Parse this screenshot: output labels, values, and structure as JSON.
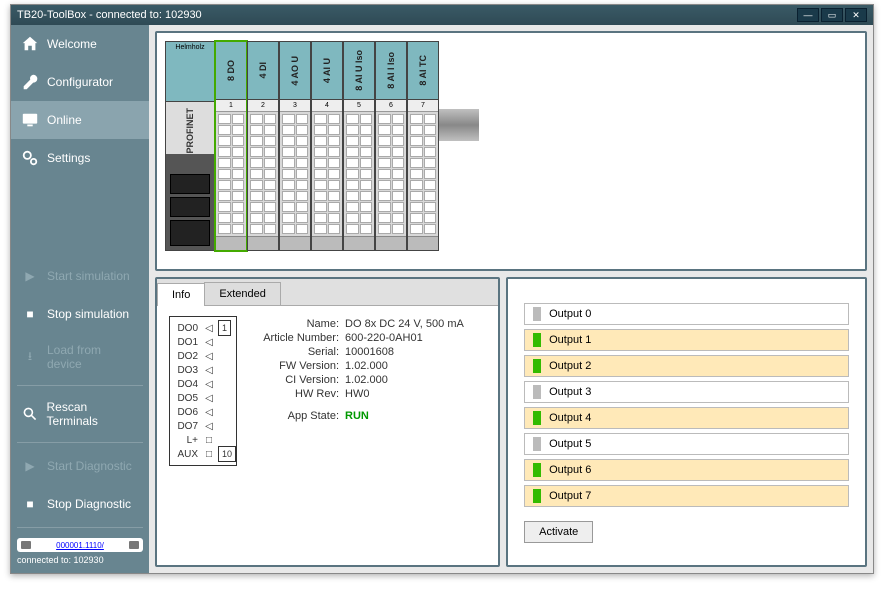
{
  "window": {
    "title": "TB20-ToolBox - connected to: 102930"
  },
  "sidebar": {
    "items": [
      {
        "label": "Welcome",
        "icon": "home-icon"
      },
      {
        "label": "Configurator",
        "icon": "wrench-icon"
      },
      {
        "label": "Online",
        "icon": "monitor-icon",
        "selected": true
      },
      {
        "label": "Settings",
        "icon": "gears-icon"
      }
    ],
    "actions": [
      {
        "label": "Start simulation",
        "icon": "play-icon",
        "disabled": true
      },
      {
        "label": "Stop simulation",
        "icon": "stop-icon",
        "disabled": false
      },
      {
        "label": "Load from device",
        "icon": "download-icon",
        "disabled": true
      }
    ],
    "rescan": "Rescan Terminals",
    "diag": [
      {
        "label": "Start Diagnostic",
        "icon": "play-icon",
        "disabled": true
      },
      {
        "label": "Stop Diagnostic",
        "icon": "stop-icon",
        "disabled": false
      }
    ],
    "connection": {
      "link": "000001.1110/",
      "status": "connected to: 102930"
    }
  },
  "rack": {
    "coupler": {
      "brand": "Helmholz",
      "label": "PROFINET"
    },
    "modules": [
      {
        "slot": "1",
        "label": "8 DO",
        "selected": true
      },
      {
        "slot": "2",
        "label": "4 DI"
      },
      {
        "slot": "3",
        "label": "4 AO U"
      },
      {
        "slot": "4",
        "label": "4 AI U"
      },
      {
        "slot": "5",
        "label": "8 AI U Iso"
      },
      {
        "slot": "6",
        "label": "8 AI I Iso"
      },
      {
        "slot": "7",
        "label": "8 AI TC"
      }
    ]
  },
  "tabs": {
    "info": "Info",
    "extended": "Extended"
  },
  "pinout": {
    "pins": [
      "DO0",
      "DO1",
      "DO2",
      "DO3",
      "DO4",
      "DO5",
      "DO6",
      "DO7",
      "L+",
      "AUX"
    ],
    "top_num": "1",
    "bottom_num": "10"
  },
  "info": {
    "name_k": "Name:",
    "name_v": "DO 8x DC 24 V, 500 mA",
    "art_k": "Article Number:",
    "art_v": "600-220-0AH01",
    "serial_k": "Serial:",
    "serial_v": "10001608",
    "fw_k": "FW Version:",
    "fw_v": "1.02.000",
    "ci_k": "CI Version:",
    "ci_v": "1.02.000",
    "hw_k": "HW Rev:",
    "hw_v": "HW0",
    "app_k": "App State:",
    "app_v": "RUN"
  },
  "outputs": {
    "items": [
      {
        "label": "Output 0",
        "on": false
      },
      {
        "label": "Output 1",
        "on": true
      },
      {
        "label": "Output 2",
        "on": true
      },
      {
        "label": "Output 3",
        "on": false
      },
      {
        "label": "Output 4",
        "on": true
      },
      {
        "label": "Output 5",
        "on": false
      },
      {
        "label": "Output 6",
        "on": true
      },
      {
        "label": "Output 7",
        "on": true
      }
    ],
    "activate": "Activate"
  }
}
